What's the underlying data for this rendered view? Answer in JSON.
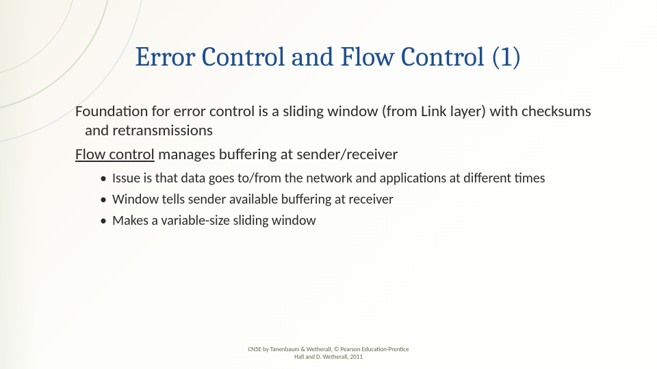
{
  "title": "Error Control and Flow Control (1)",
  "body": {
    "p1": "Foundation for error control is a sliding window (from Link layer) with checksums and retransmissions",
    "p2_underlined": "Flow control",
    "p2_rest": " manages buffering at sender/receiver",
    "bullets": [
      "Issue is that data goes to/from the network and   applications at different times",
      "Window tells sender available buffering at receiver",
      "Makes a variable-size sliding window"
    ]
  },
  "footer": {
    "line1": "CN5E by Tanenbaum & Wetherall, © Pearson Education-Prentice",
    "line2": "Hall and D. Wetherall, 2011"
  },
  "colors": {
    "title": "#1d4e8f",
    "text": "#2a2a2a",
    "footer": "#5c6a4a"
  }
}
